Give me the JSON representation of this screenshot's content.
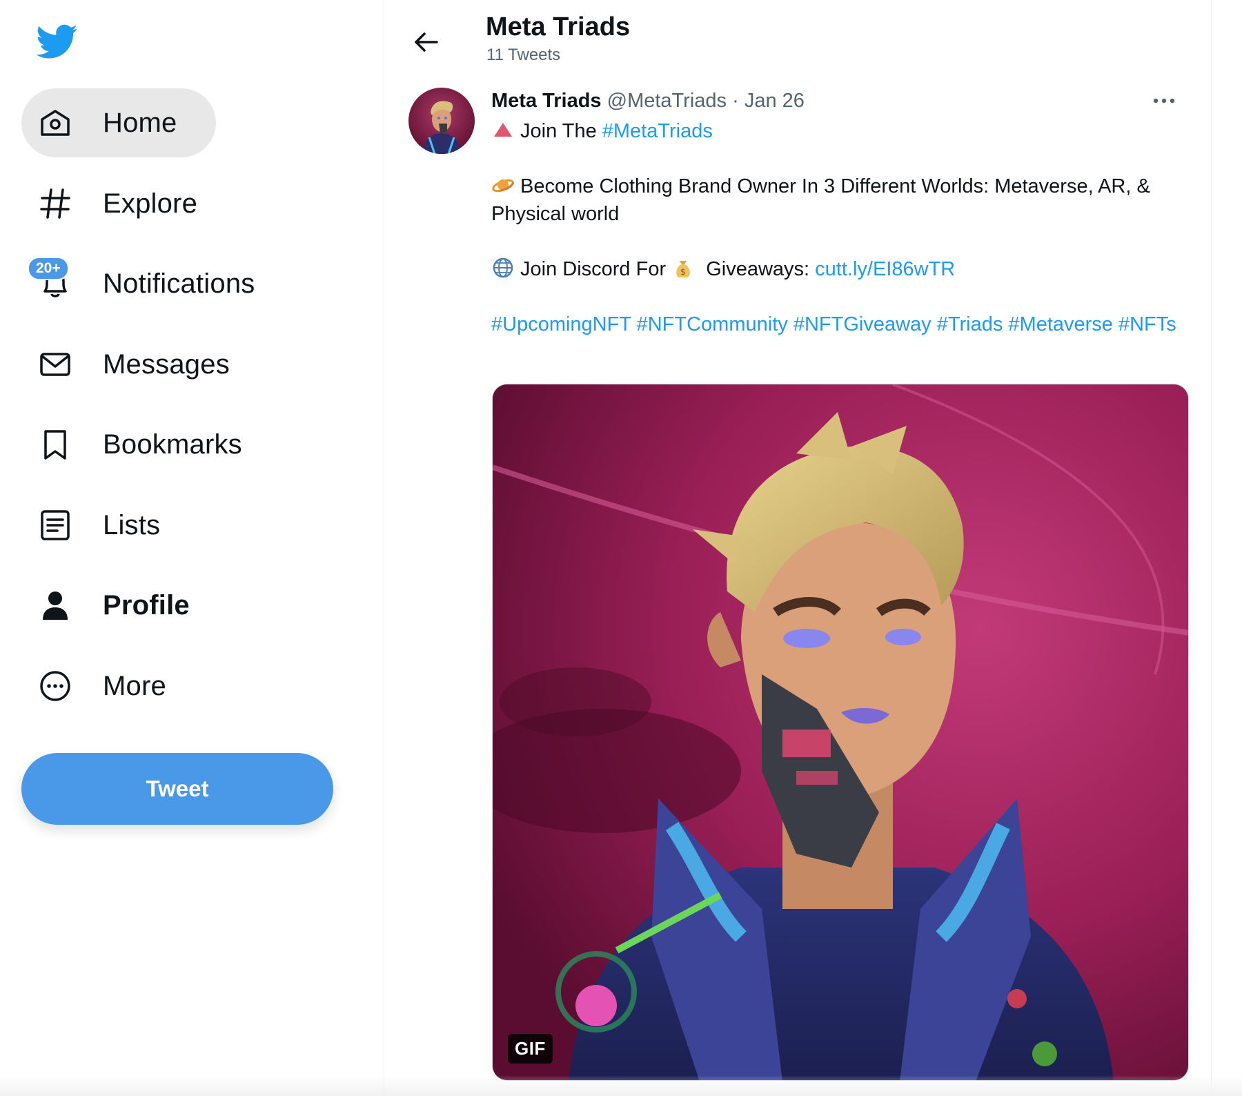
{
  "colors": {
    "accent": "#1d9bf0",
    "button": "#4a99e9",
    "active_nav_bg": "#e8e8e8",
    "text_secondary": "#536471"
  },
  "sidebar": {
    "logo_icon": "twitter-bird-icon",
    "items": [
      {
        "label": "Home",
        "icon": "home-icon",
        "active": true
      },
      {
        "label": "Explore",
        "icon": "hashtag-icon"
      },
      {
        "label": "Notifications",
        "icon": "bell-icon",
        "badge": "20+"
      },
      {
        "label": "Messages",
        "icon": "envelope-icon"
      },
      {
        "label": "Bookmarks",
        "icon": "bookmark-icon"
      },
      {
        "label": "Lists",
        "icon": "list-icon"
      },
      {
        "label": "Profile",
        "icon": "person-icon",
        "bold": true
      },
      {
        "label": "More",
        "icon": "more-circle-icon"
      }
    ],
    "tweet_button": "Tweet"
  },
  "header": {
    "title": "Meta Triads",
    "subtitle": "11 Tweets"
  },
  "tweet": {
    "display_name": "Meta Triads",
    "handle": "@MetaTriads",
    "separator": "·",
    "date": "Jan 26",
    "line1_prefix": "Join The ",
    "line1_hashtag": "#MetaTriads",
    "line2": "Become Clothing Brand Owner In 3 Different Worlds: Metaverse, AR, & Physical world",
    "line3_prefix": "Join Discord For ",
    "line3_middle": " Giveaways: ",
    "line3_link": "cutt.ly/EI86wTR",
    "hashtags": [
      "#UpcomingNFT",
      "#NFTCommunity",
      "#NFTGiveaway",
      "#Triads",
      "#Metaverse",
      "#NFTs"
    ],
    "media_badge": "GIF"
  }
}
